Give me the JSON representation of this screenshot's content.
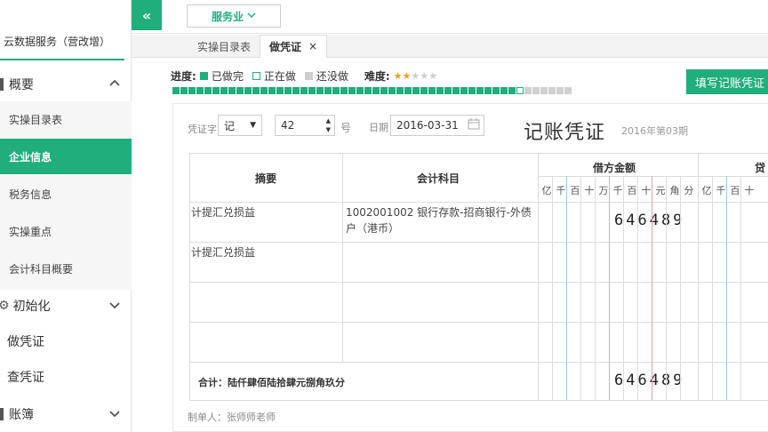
{
  "sidebar": {
    "brand": "云数据服务（营改增）",
    "sections": [
      {
        "label": "概要",
        "expanded": true
      },
      {
        "label": "初始化",
        "expanded": false
      },
      {
        "label": "做凭证"
      },
      {
        "label": "查凭证"
      },
      {
        "label": "账簿",
        "expanded": false
      }
    ],
    "overview_items": [
      "实操目录表",
      "企业信息",
      "税务信息",
      "实操重点",
      "会计科目概要"
    ],
    "active_item": "企业信息"
  },
  "topbar": {
    "collapse_icon": "«",
    "industry": "服务业"
  },
  "tabs": [
    {
      "label": "实操目录表"
    },
    {
      "label": "做凭证",
      "close": "×"
    }
  ],
  "progress": {
    "label": "进度:",
    "legend_done": "已做完",
    "legend_doing": "正在做",
    "legend_todo": "还没做",
    "difficulty_label": "难度:",
    "difficulty_stars": 2,
    "difficulty_max": 5,
    "segments_done": 43,
    "segments_doing": 1,
    "segments_todo": 6
  },
  "fill_button": "填写记账凭证",
  "voucher": {
    "word_label": "凭证字",
    "word_value": "记",
    "number_value": "42",
    "number_suffix": "号",
    "date_label": "日期",
    "date_value": "2016-03-31",
    "title": "记账凭证",
    "period": "2016年第03期",
    "col_summary": "摘要",
    "col_account": "会计科目",
    "col_debit": "借方金额",
    "col_credit": "贷",
    "digits": [
      "亿",
      "千",
      "百",
      "十",
      "万",
      "千",
      "百",
      "十",
      "元",
      "角",
      "分"
    ],
    "credit_digits": [
      "亿",
      "千",
      "百",
      "十"
    ],
    "rows": [
      {
        "summary": "计提汇兑损益",
        "account_line1": "1002001002 银行存款-招商银行-外债",
        "account_line2": "户（港币）",
        "debit": "646489"
      },
      {
        "summary": "计提汇兑损益",
        "account_line1": "",
        "account_line2": "",
        "debit": ""
      },
      {
        "summary": "",
        "account_line1": "",
        "account_line2": "",
        "debit": ""
      },
      {
        "summary": "",
        "account_line1": "",
        "account_line2": "",
        "debit": ""
      }
    ],
    "total_label": "合计：陆仟肆佰陆拾肆元捌角玖分",
    "total_debit": "646489",
    "maker": "制单人：张师师老师"
  },
  "colors": {
    "accent": "#1fae7c"
  }
}
